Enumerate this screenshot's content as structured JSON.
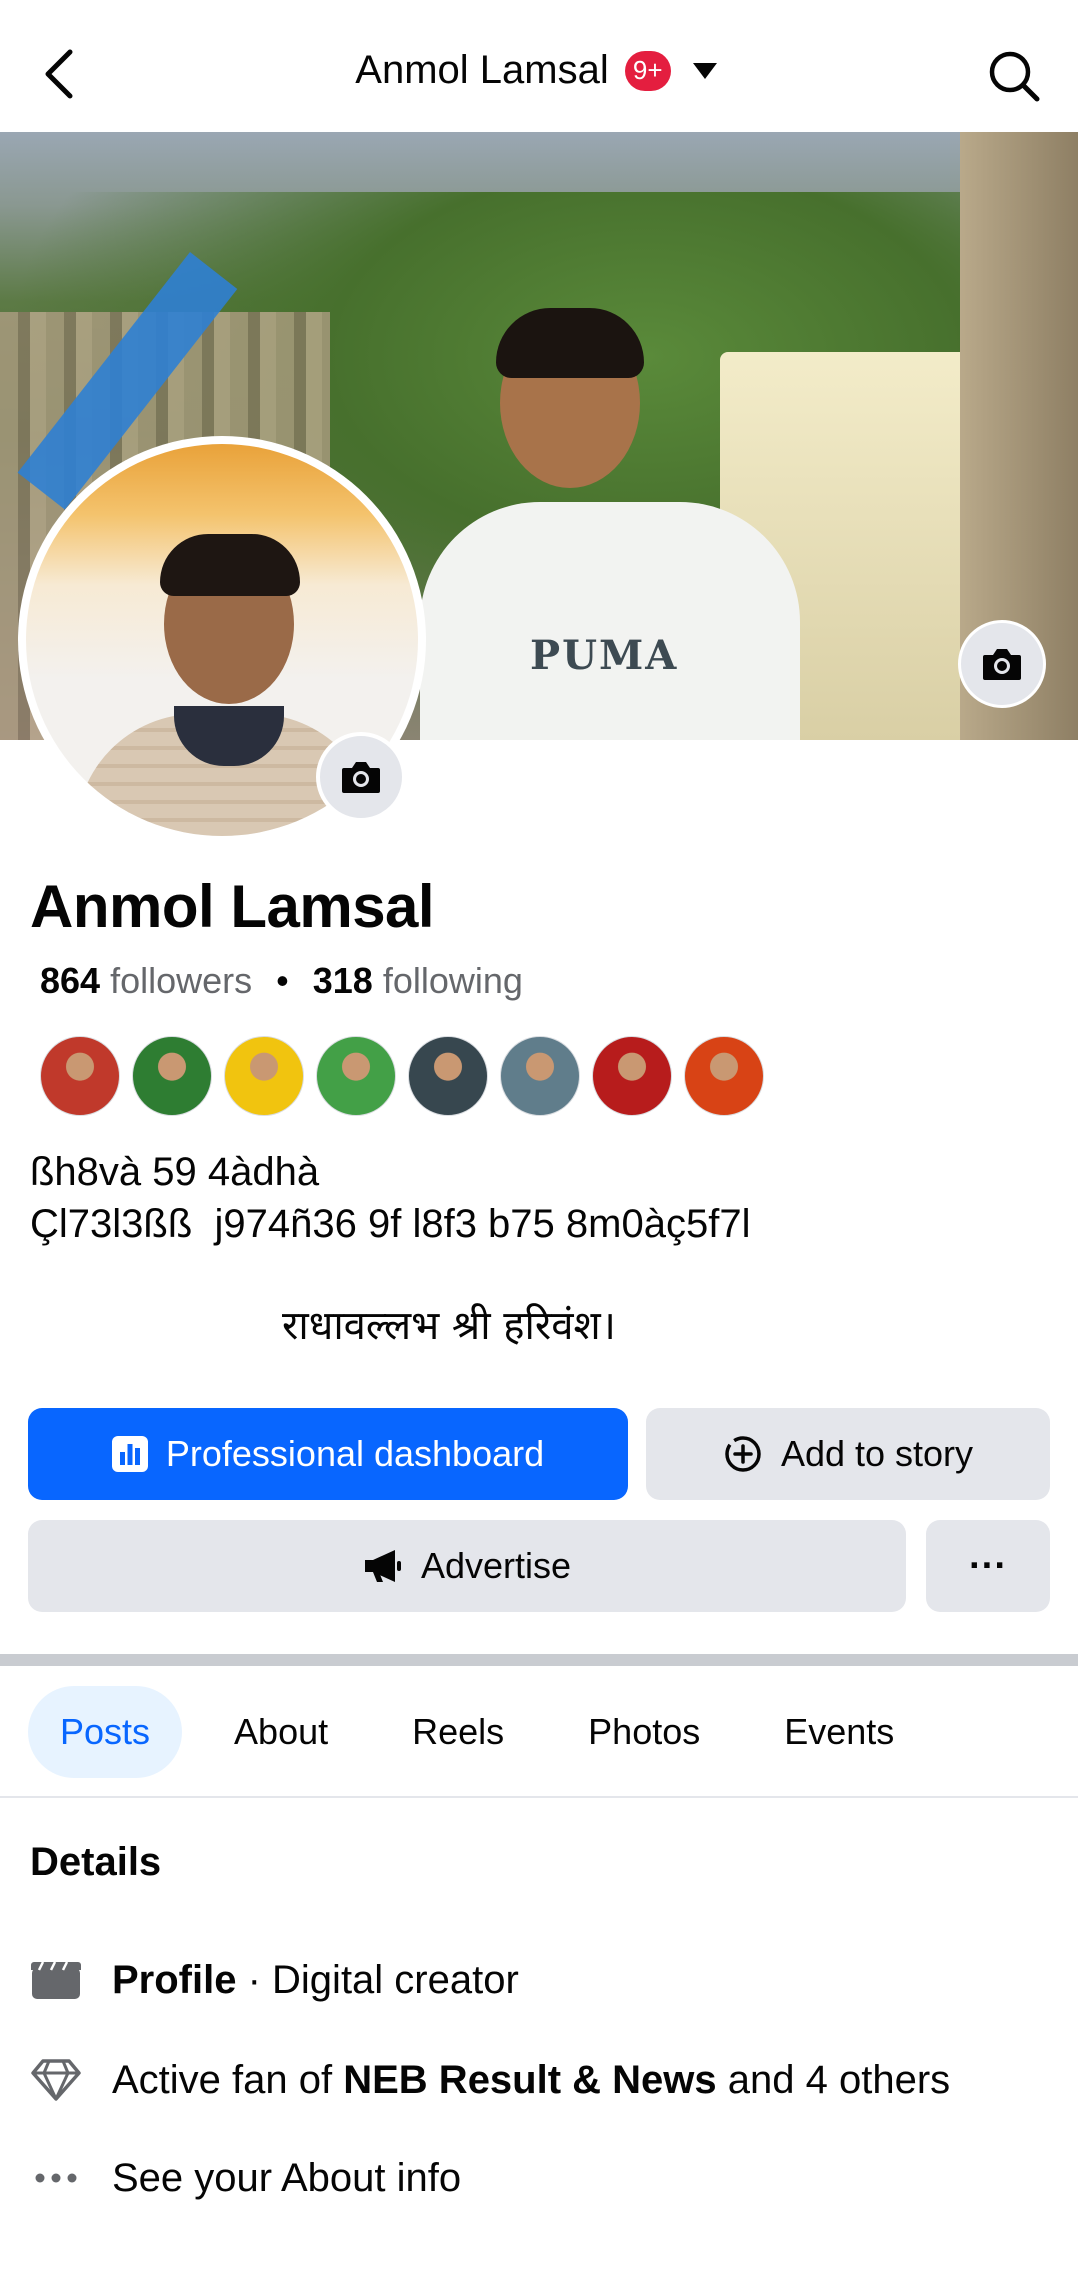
{
  "topbar": {
    "title": "Anmol Lamsal",
    "notification_badge": "9+"
  },
  "profile": {
    "name": "Anmol Lamsal",
    "followers_count": "864",
    "followers_label": "followers",
    "following_count": "318",
    "following_label": "following",
    "separator": "•",
    "bio_line1": "ßh8và 59 4àdhà",
    "bio_line2": "Çl73l3ßß  j974ñ36 9f l8f3 b75 8m0àç5f7l",
    "bio_line3": "राधावल्लभ श्री हरिवंश।",
    "cover_shirt_text": "PUMA"
  },
  "friends": [
    {
      "color": "#c0392b"
    },
    {
      "color": "#2e7d32"
    },
    {
      "color": "#f1c40f"
    },
    {
      "color": "#43a047"
    },
    {
      "color": "#37474f"
    },
    {
      "color": "#607d8b"
    },
    {
      "color": "#b71c1c"
    },
    {
      "color": "#d84315"
    }
  ],
  "actions": {
    "professional_dashboard": "Professional dashboard",
    "add_to_story": "Add to story",
    "advertise": "Advertise",
    "more": "···"
  },
  "tabs": [
    {
      "label": "Posts",
      "active": true
    },
    {
      "label": "About",
      "active": false
    },
    {
      "label": "Reels",
      "active": false
    },
    {
      "label": "Photos",
      "active": false
    },
    {
      "label": "Events",
      "active": false
    }
  ],
  "details": {
    "title": "Details",
    "profile_bold": "Profile",
    "profile_rest": " · Digital creator",
    "fan_prefix": "Active fan of ",
    "fan_bold": "NEB Result & News",
    "fan_suffix": " and 4 others",
    "about_info": "See your About info"
  },
  "icons": {
    "back": "chevron-left-icon",
    "caret": "caret-down-icon",
    "search": "search-icon",
    "camera": "camera-icon",
    "dashboard": "bar-chart-icon",
    "story": "add-circle-icon",
    "advertise": "megaphone-icon",
    "profile": "clapperboard-icon",
    "fan": "diamond-icon",
    "about": "more-dots-icon"
  },
  "colors": {
    "primary": "#0866ff",
    "badge": "#e41e3f",
    "secondary_button": "#e4e6eb"
  }
}
